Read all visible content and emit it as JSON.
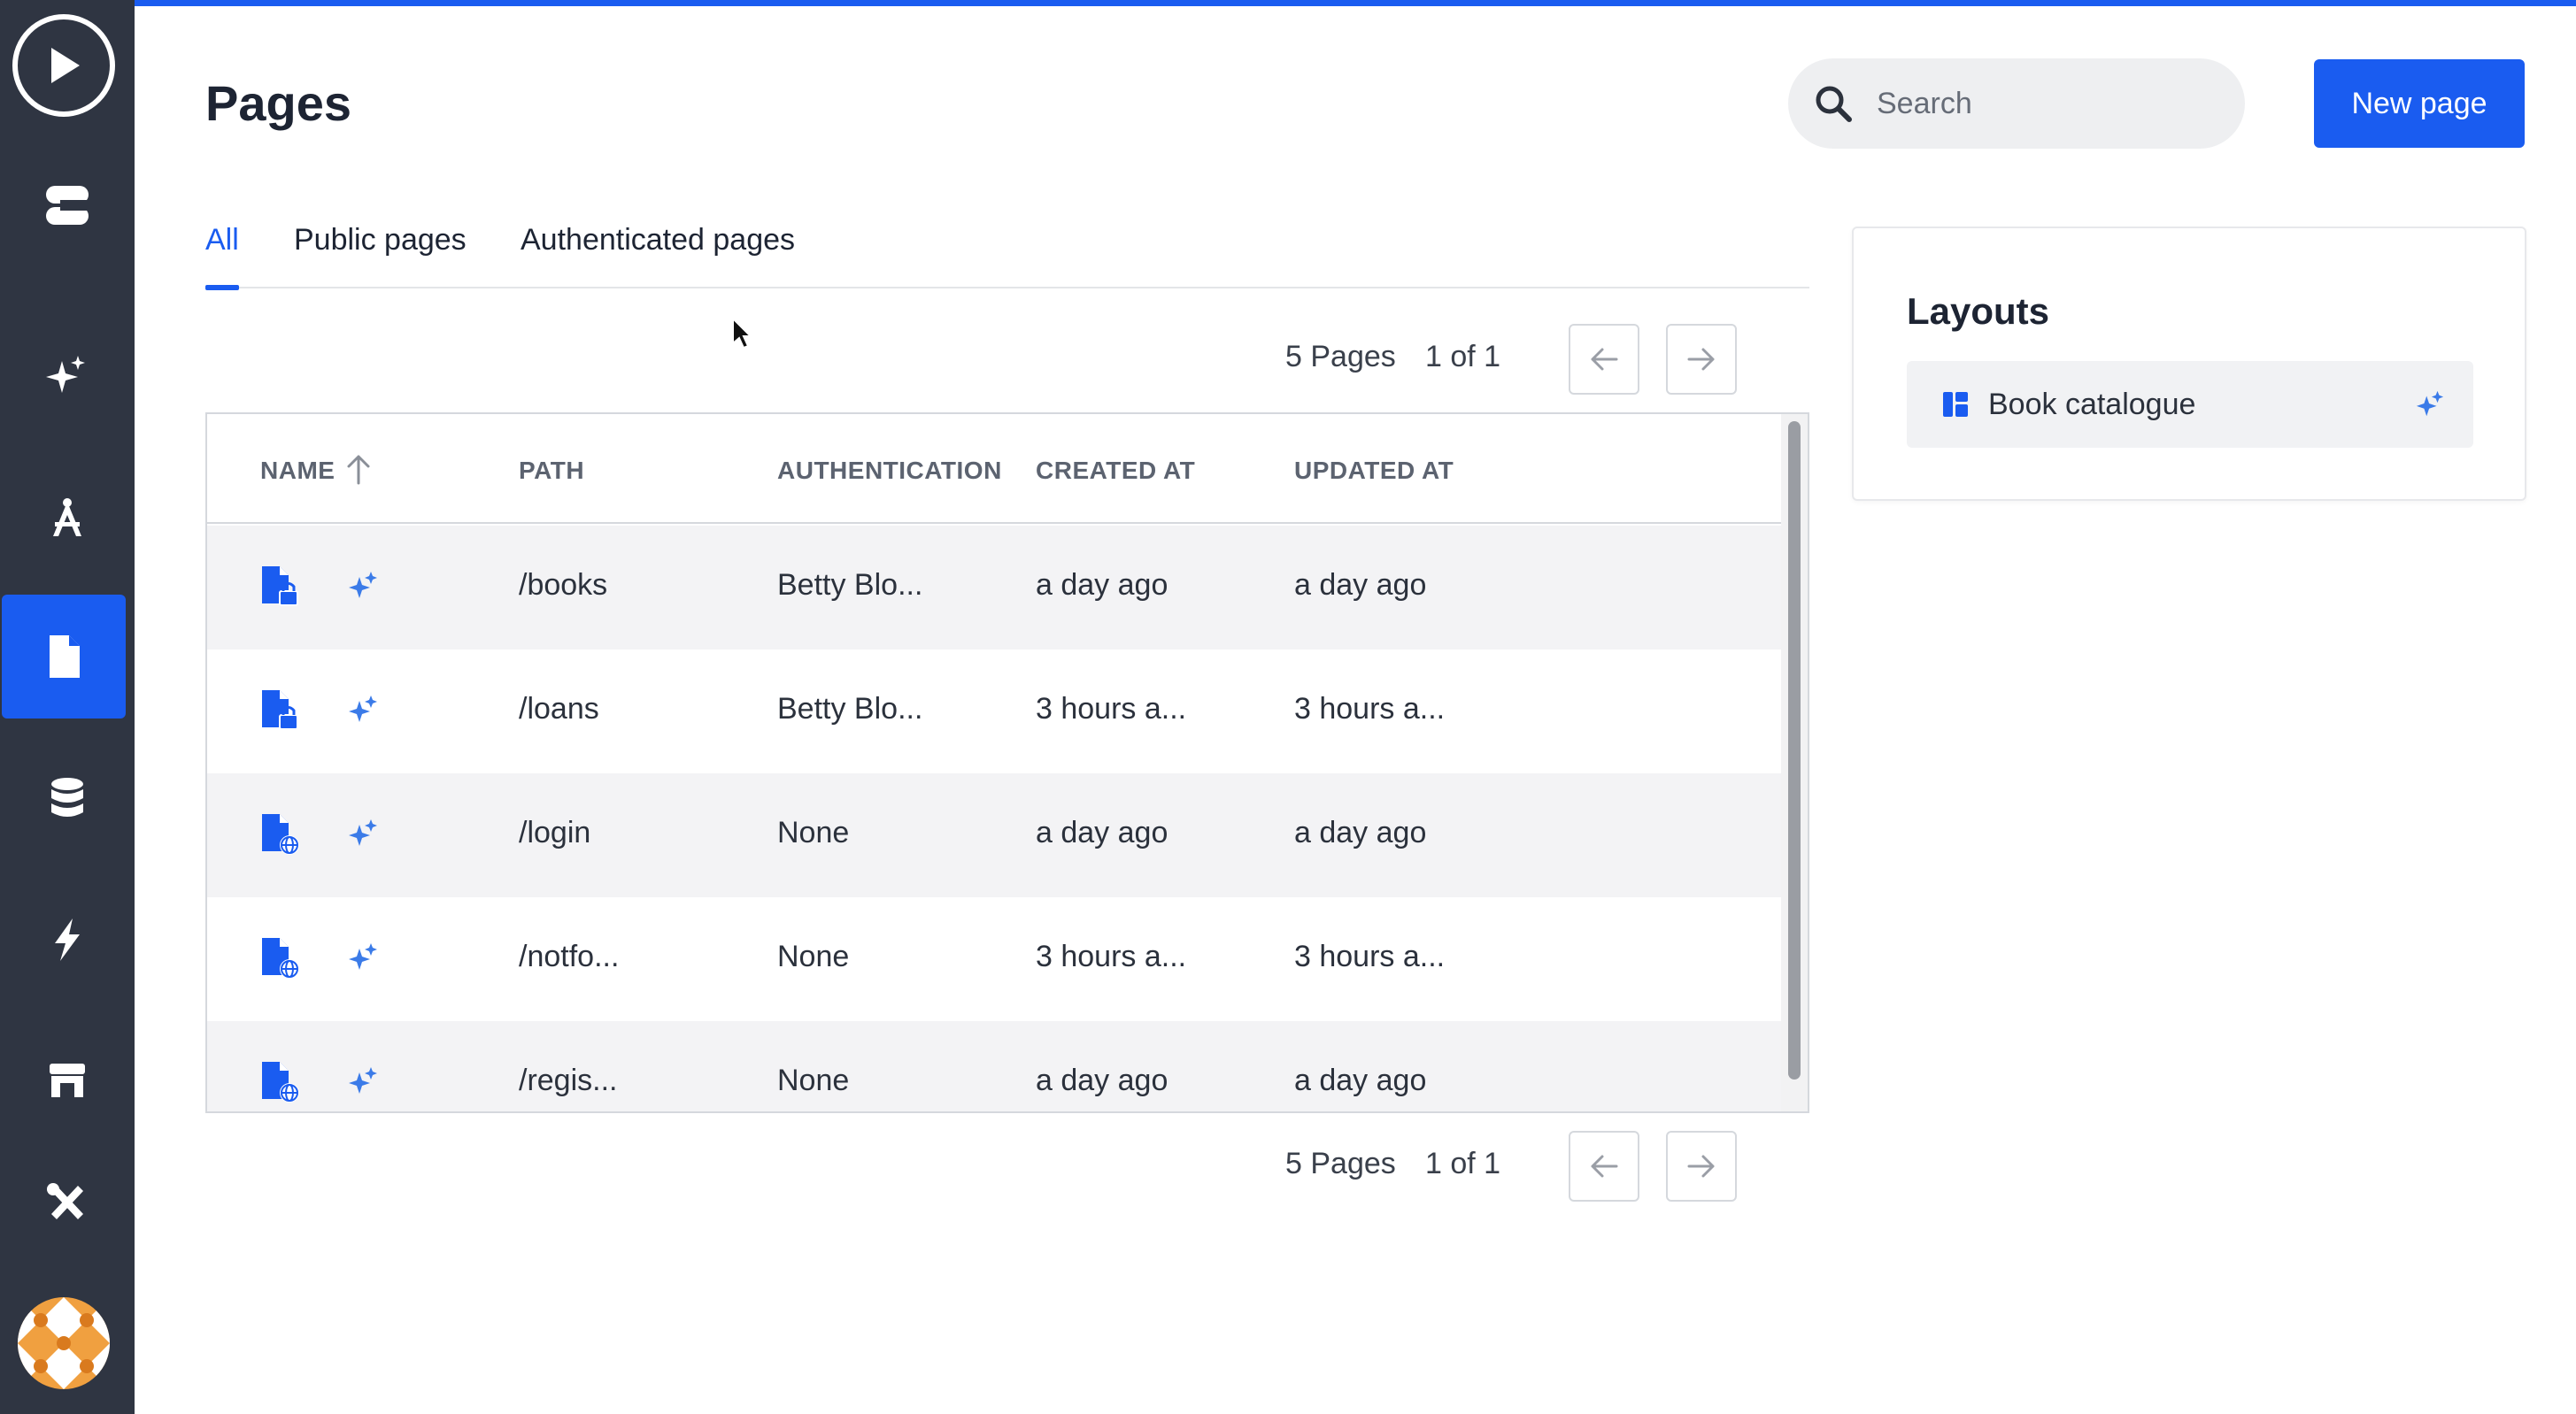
{
  "sidebar": {
    "items": [
      {
        "name": "play",
        "icon": "play-icon"
      },
      {
        "name": "app",
        "icon": "app-icon"
      },
      {
        "name": "ai",
        "icon": "sparkle-icon"
      },
      {
        "name": "design",
        "icon": "compass-icon"
      },
      {
        "name": "pages",
        "icon": "page-icon",
        "active": true
      },
      {
        "name": "data",
        "icon": "database-icon"
      },
      {
        "name": "actions",
        "icon": "lightning-icon"
      },
      {
        "name": "store",
        "icon": "store-icon"
      },
      {
        "name": "tools",
        "icon": "tools-icon"
      }
    ],
    "accent": "#1a5cf0",
    "background": "#2f3542"
  },
  "header": {
    "title": "Pages",
    "search_placeholder": "Search",
    "new_page_label": "New page"
  },
  "tabs": [
    {
      "label": "All",
      "active": true
    },
    {
      "label": "Public pages",
      "active": false
    },
    {
      "label": "Authenticated pages",
      "active": false
    }
  ],
  "pager": {
    "count": "5 Pages",
    "position": "1 of 1"
  },
  "table": {
    "columns": [
      "NAME",
      "PATH",
      "AUTHENTICATION",
      "CREATED AT",
      "UPDATED AT"
    ],
    "sort": {
      "column": "NAME",
      "direction": "ascending"
    },
    "rows": [
      {
        "icon": "page-lock-icon",
        "path": "/books",
        "authentication": "Betty Blo...",
        "created_at": "a day ago",
        "updated_at": "a day ago"
      },
      {
        "icon": "page-lock-icon",
        "path": "/loans",
        "authentication": "Betty Blo...",
        "created_at": "3 hours a...",
        "updated_at": "3 hours a..."
      },
      {
        "icon": "page-globe-icon",
        "path": "/login",
        "authentication": "None",
        "created_at": "a day ago",
        "updated_at": "a day ago"
      },
      {
        "icon": "page-globe-icon",
        "path": "/notfo...",
        "authentication": "None",
        "created_at": "3 hours a...",
        "updated_at": "3 hours a..."
      },
      {
        "icon": "page-globe-icon",
        "path": "/regis...",
        "authentication": "None",
        "created_at": "a day ago",
        "updated_at": "a day ago"
      }
    ]
  },
  "layouts": {
    "title": "Layouts",
    "items": [
      {
        "label": "Book catalogue",
        "icon": "layout-icon"
      }
    ]
  }
}
